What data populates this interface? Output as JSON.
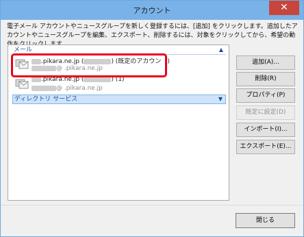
{
  "window": {
    "title": "アカウント",
    "close_glyph": "✕"
  },
  "instructions": "電子メール アカウントやニュースグループを新しく登録するには、[追加] をクリックします。追加したアカウントやニュースグループを編集、エクスポート、削除するには、対象をクリックしてから、希望の動作をクリックします。",
  "list": {
    "mail_group_label": "メール",
    "directory_group_label": "ディレクトリ サービス",
    "accounts": [
      {
        "server_suffix": ".pikara.ne.jp",
        "paren_open": "(",
        "tag": ") (既定のアカウン　)",
        "email_suffix": "@ .pikara.ne.jp"
      },
      {
        "server_suffix": ".pikara.ne.jp",
        "paren_open": "(",
        "tag": ") (1)",
        "email_suffix": "@ .pikara.ne.jp"
      }
    ]
  },
  "buttons": {
    "add": "追加(A)...",
    "delete": "削除(R)",
    "properties": "プロパティ(P)",
    "set_default": "既定に設定(D)",
    "import": "インポート(I)...",
    "export": "エクスポート(E)...",
    "close": "閉じる"
  },
  "icons": {
    "collapse": "chevron-up-icon",
    "expand": "chevron-down-icon",
    "account": "mail-account-icon"
  }
}
